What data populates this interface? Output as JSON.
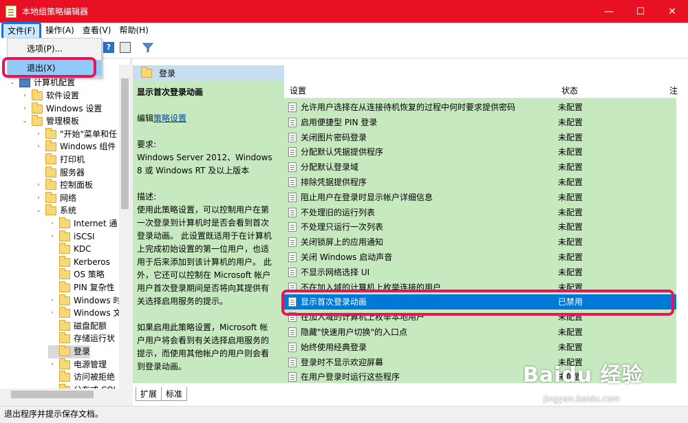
{
  "window": {
    "title": "本地组策略编辑器"
  },
  "window_buttons": {
    "minimize": "—",
    "maximize": "☐",
    "close": "✕"
  },
  "menu": {
    "file": "文件(F)",
    "action": "操作(A)",
    "view": "查看(V)",
    "help": "帮助(H)"
  },
  "file_menu": {
    "options": "选项(P)...",
    "exit": "退出(X)"
  },
  "tree": {
    "root": "计算机配置",
    "items": [
      "软件设置",
      "Windows 设置",
      "管理模板",
      "\"开始\"菜单和任",
      "Windows 组件",
      "打印机",
      "服务器",
      "控制面板",
      "网络",
      "系统",
      "Internet 通",
      "iSCSI",
      "KDC",
      "Kerberos",
      "OS 策略",
      "PIN 复杂性",
      "Windows 时",
      "Windows 文",
      "磁盘配额",
      "存储运行状",
      "登录",
      "电源管理",
      "访问被拒绝",
      "分布式 COI"
    ]
  },
  "panel": {
    "header": "登录",
    "desc_title": "显示首次登录动画",
    "edit_prefix": "编辑",
    "edit_link": "策略设置",
    "req_label": "要求:",
    "req_text": "Windows Server 2012、Windows 8 或 Windows RT 及以上版本",
    "desc_label": "描述:",
    "desc_text": "使用此策略设置，可以控制用户在第一次登录到计算机时是否会看到首次登录动画。 此设置既适用于在计算机上完成初始设置的第一位用户，也适用于后来添加到该计算机的用户。 此外，它还可以控制在 Microsoft 帐户用户首次登录期间是否将向其提供有关选择启用服务的提示。",
    "desc_text2": "如果启用此策略设置，Microsoft 帐户用户将会看到有关选择启用服务的提示，而使用其他帐户的用户则会看到登录动画。"
  },
  "list": {
    "col_setting": "设置",
    "col_state": "状态",
    "col_extra": "注",
    "rows": [
      {
        "name": "允许用户选择在从连接待机恢复的过程中何时要求提供密码",
        "state": "未配置"
      },
      {
        "name": "启用便捷型 PIN 登录",
        "state": "未配置"
      },
      {
        "name": "关闭图片密码登录",
        "state": "未配置"
      },
      {
        "name": "分配默认凭据提供程序",
        "state": "未配置"
      },
      {
        "name": "分配默认登录域",
        "state": "未配置"
      },
      {
        "name": "排除凭据提供程序",
        "state": "未配置"
      },
      {
        "name": "阻止用户在登录时显示帐户详细信息",
        "state": "未配置"
      },
      {
        "name": "不处理旧的运行列表",
        "state": "未配置"
      },
      {
        "name": "不处理只运行一次列表",
        "state": "未配置"
      },
      {
        "name": "关闭锁屏上的应用通知",
        "state": "未配置"
      },
      {
        "name": "关闭 Windows 启动声音",
        "state": "未配置"
      },
      {
        "name": "不显示网络选择 UI",
        "state": "未配置"
      },
      {
        "name": "不在加入域的计算机上枚举连接的用户",
        "state": "未配置"
      },
      {
        "name": "显示首次登录动画",
        "state": "已禁用"
      },
      {
        "name": "在加入域的计算机上枚举本地用户",
        "state": "未配置"
      },
      {
        "name": "隐藏\"快速用户切换\"的入口点",
        "state": "未配置"
      },
      {
        "name": "始终使用经典登录",
        "state": "未配置"
      },
      {
        "name": "登录时不显示欢迎屏幕",
        "state": "未配置"
      },
      {
        "name": "在用户登录时运行这些程序",
        "state": "未配置"
      }
    ]
  },
  "tabs": {
    "extended": "扩展",
    "standard": "标准"
  },
  "status": {
    "text": "退出程序并提示保存文档。"
  },
  "watermark": {
    "main": "Baidu 经验",
    "sub": "jingyan.baidu.com"
  },
  "colors": {
    "titlebar": "#e81123",
    "highlight_box": "#e8145a",
    "selection": "#0078d7",
    "description_bg": "#c7e9c0"
  }
}
